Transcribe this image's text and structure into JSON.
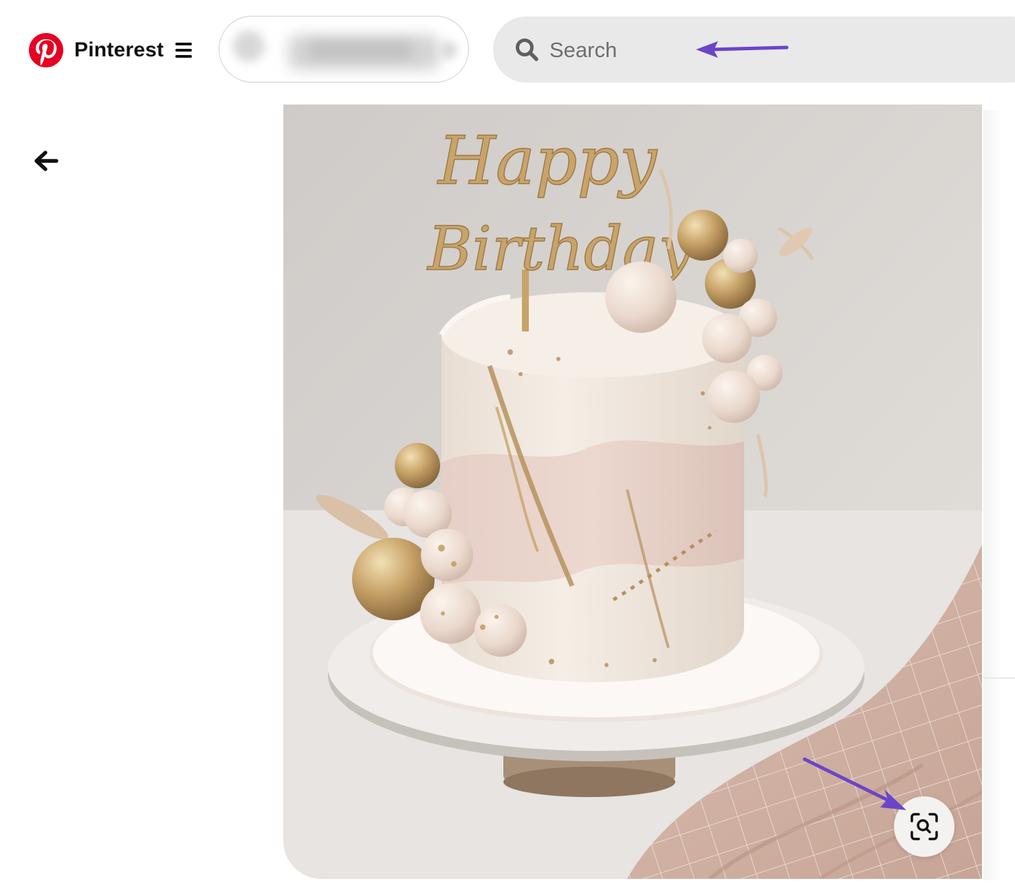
{
  "header": {
    "brand_name": "Pinterest",
    "search": {
      "placeholder": "Search",
      "value": ""
    }
  },
  "pin": {
    "topper_text": [
      "Happy",
      "Birthday"
    ]
  },
  "colors": {
    "brand_red": "#E60023",
    "annotation_arrow": "#6B45C8",
    "search_bg": "#E9E9E9"
  },
  "icons": [
    "pinterest-logo-icon",
    "menu-icon",
    "search-icon",
    "back-arrow-icon",
    "visual-search-icon"
  ]
}
